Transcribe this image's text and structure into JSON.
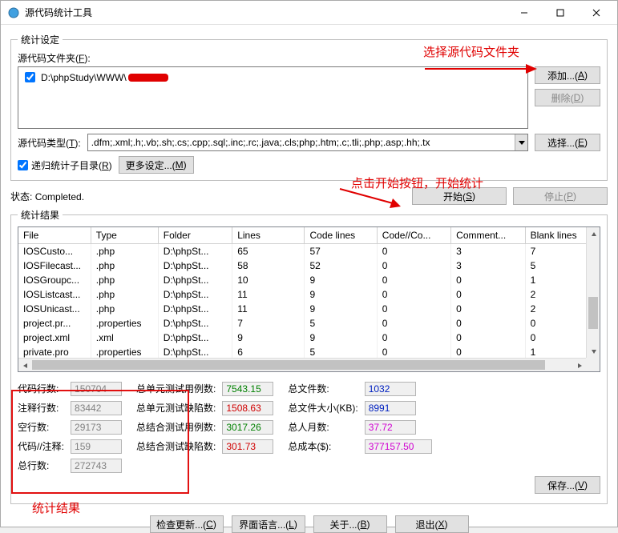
{
  "window": {
    "title": "源代码统计工具"
  },
  "settings": {
    "legend": "统计设定",
    "folder_label": "源代码文件夹(F):",
    "folder_item": "D:\\phpStudy\\WWW\\",
    "add_btn": "添加...(A)",
    "delete_btn": "删除(D)",
    "type_label": "源代码类型(T):",
    "type_value": ".dfm;.xml;.h;.vb;.sh;.cs;.cpp;.sql;.inc;.rc;.java;.cls;php;.htm;.c;.tli;.php;.asp;.hh;.tx",
    "select_btn": "选择...(E)",
    "recursive_label": "递归统计子目录(R)",
    "more_btn": "更多设定...(M)"
  },
  "status": {
    "label": "状态:",
    "value": "Completed.",
    "start_btn": "开始(S)",
    "stop_btn": "停止(P)"
  },
  "results": {
    "legend": "统计结果",
    "headers": [
      "File",
      "Type",
      "Folder",
      "Lines",
      "Code lines",
      "Code//Co...",
      "Comment...",
      "Blank lines"
    ],
    "rows": [
      [
        "IOSCusto...",
        ".php",
        "D:\\phpSt...",
        "65",
        "57",
        "0",
        "3",
        "7"
      ],
      [
        "IOSFilecast...",
        ".php",
        "D:\\phpSt...",
        "58",
        "52",
        "0",
        "3",
        "5"
      ],
      [
        "IOSGroupc...",
        ".php",
        "D:\\phpSt...",
        "10",
        "9",
        "0",
        "0",
        "1"
      ],
      [
        "IOSListcast...",
        ".php",
        "D:\\phpSt...",
        "11",
        "9",
        "0",
        "0",
        "2"
      ],
      [
        "IOSUnicast...",
        ".php",
        "D:\\phpSt...",
        "11",
        "9",
        "0",
        "0",
        "2"
      ],
      [
        "project.pr...",
        ".properties",
        "D:\\phpSt...",
        "7",
        "5",
        "0",
        "0",
        "0"
      ],
      [
        "project.xml",
        ".xml",
        "D:\\phpSt...",
        "9",
        "9",
        "0",
        "0",
        "0"
      ],
      [
        "private.pro",
        ".properties",
        "D:\\phpSt...",
        "6",
        "5",
        "0",
        "0",
        "1"
      ]
    ]
  },
  "totals_left": {
    "code_lines_label": "代码行数:",
    "code_lines": "150704",
    "comment_lines_label": "注释行数:",
    "comment_lines": "83442",
    "blank_lines_label": "空行数:",
    "blank_lines": "29173",
    "code_comment_label": "代码//注释:",
    "code_comment": "159",
    "total_lines_label": "总行数:",
    "total_lines": "272743"
  },
  "totals_mid": {
    "unit_cases_label": "总单元测试用例数:",
    "unit_cases": "7543.15",
    "unit_defects_label": "总单元测试缺陷数:",
    "unit_defects": "1508.63",
    "int_cases_label": "总结合测试用例数:",
    "int_cases": "3017.26",
    "int_defects_label": "总结合测试缺陷数:",
    "int_defects": "301.73"
  },
  "totals_right": {
    "file_count_label": "总文件数:",
    "file_count": "1032",
    "file_size_label": "总文件大小(KB):",
    "file_size": "8991",
    "man_month_label": "总人月数:",
    "man_month": "37.72",
    "cost_label": "总成本($):",
    "cost": "377157.50"
  },
  "save_btn": "保存...(V)",
  "bottom": {
    "check_update": "检查更新...(C)",
    "language": "界面语言...(L)",
    "about": "关于...(B)",
    "exit": "退出(X)"
  },
  "annotations": {
    "select_folder": "选择源代码文件夹",
    "click_start": "点击开始按钮，开始统计",
    "results": "统计结果"
  }
}
